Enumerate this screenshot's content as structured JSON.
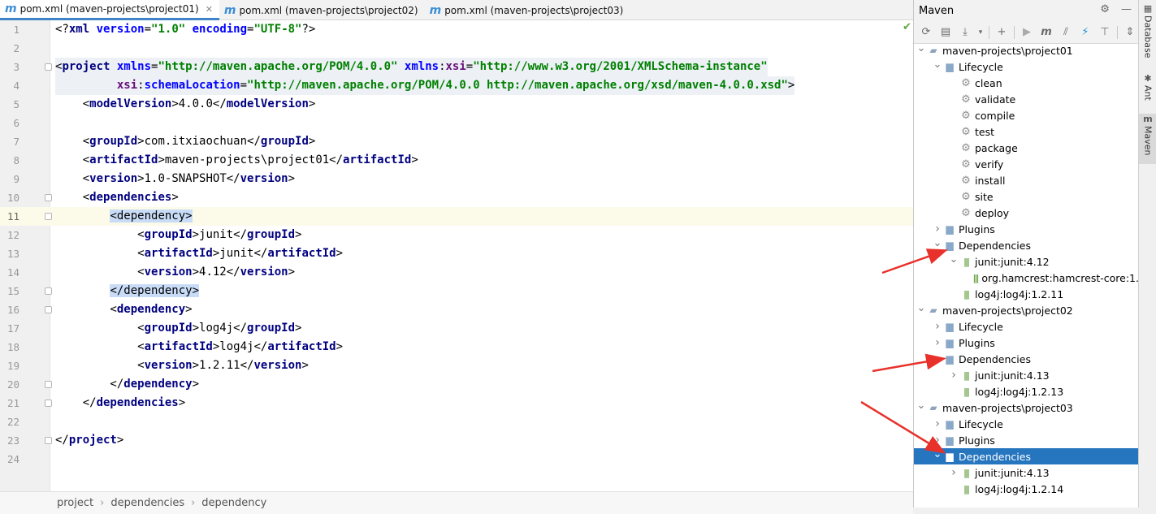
{
  "tabs": [
    {
      "label": "pom.xml (maven-projects\\project01)",
      "active": true
    },
    {
      "label": "pom.xml (maven-projects\\project02)",
      "active": false
    },
    {
      "label": "pom.xml (maven-projects\\project03)",
      "active": false
    }
  ],
  "editor": {
    "lines": [
      {
        "n": "1",
        "html": [
          [
            "pi",
            "<?"
          ],
          [
            "t",
            "xml "
          ],
          [
            "a",
            "version"
          ],
          [
            "tx",
            "="
          ],
          [
            "v",
            "\"1.0\" "
          ],
          [
            "a",
            "encoding"
          ],
          [
            "tx",
            "="
          ],
          [
            "v",
            "\"UTF-8\""
          ],
          [
            "pi",
            "?>"
          ]
        ]
      },
      {
        "n": "2",
        "html": []
      },
      {
        "n": "3",
        "fold": true,
        "hl2": true,
        "html": [
          [
            "tx",
            "<"
          ],
          [
            "t",
            "project "
          ],
          [
            "a",
            "xmlns"
          ],
          [
            "tx",
            "="
          ],
          [
            "v",
            "\"http://maven.apache.org/POM/4.0.0\" "
          ],
          [
            "a",
            "xmlns"
          ],
          [
            "tx",
            ":"
          ],
          [
            "ns",
            "xsi"
          ],
          [
            "tx",
            "="
          ],
          [
            "v",
            "\"http://www.w3.org/2001/XMLSchema-instance\""
          ]
        ]
      },
      {
        "n": "4",
        "hl2": true,
        "html": [
          [
            "tx",
            "         "
          ],
          [
            "ns",
            "xsi"
          ],
          [
            "tx",
            ":"
          ],
          [
            "a",
            "schemaLocation"
          ],
          [
            "tx",
            "="
          ],
          [
            "v",
            "\"http://maven.apache.org/POM/4.0.0 http://maven.apache.org/xsd/maven-4.0.0.xsd\""
          ],
          [
            "tx",
            ">"
          ]
        ]
      },
      {
        "n": "5",
        "html": [
          [
            "tx",
            "    <"
          ],
          [
            "t",
            "modelVersion"
          ],
          [
            "tx",
            ">4.0.0</"
          ],
          [
            "t",
            "modelVersion"
          ],
          [
            "tx",
            ">"
          ]
        ]
      },
      {
        "n": "6",
        "html": []
      },
      {
        "n": "7",
        "html": [
          [
            "tx",
            "    <"
          ],
          [
            "t",
            "groupId"
          ],
          [
            "tx",
            ">com.itxiaochuan</"
          ],
          [
            "t",
            "groupId"
          ],
          [
            "tx",
            ">"
          ]
        ]
      },
      {
        "n": "8",
        "html": [
          [
            "tx",
            "    <"
          ],
          [
            "t",
            "artifactId"
          ],
          [
            "tx",
            ">maven-projects\\project01</"
          ],
          [
            "t",
            "artifactId"
          ],
          [
            "tx",
            ">"
          ]
        ]
      },
      {
        "n": "9",
        "html": [
          [
            "tx",
            "    <"
          ],
          [
            "t",
            "version"
          ],
          [
            "tx",
            ">1.0-SNAPSHOT</"
          ],
          [
            "t",
            "version"
          ],
          [
            "tx",
            ">"
          ]
        ]
      },
      {
        "n": "10",
        "fold": true,
        "html": [
          [
            "tx",
            "    <"
          ],
          [
            "t",
            "dependencies"
          ],
          [
            "tx",
            ">"
          ]
        ]
      },
      {
        "n": "11",
        "fold": true,
        "current": true,
        "html": [
          [
            "tx",
            "        "
          ],
          [
            "hl",
            "<dependency>"
          ]
        ]
      },
      {
        "n": "12",
        "html": [
          [
            "tx",
            "            <"
          ],
          [
            "t",
            "groupId"
          ],
          [
            "tx",
            ">junit</"
          ],
          [
            "t",
            "groupId"
          ],
          [
            "tx",
            ">"
          ]
        ]
      },
      {
        "n": "13",
        "html": [
          [
            "tx",
            "            <"
          ],
          [
            "t",
            "artifactId"
          ],
          [
            "tx",
            ">junit</"
          ],
          [
            "t",
            "artifactId"
          ],
          [
            "tx",
            ">"
          ]
        ]
      },
      {
        "n": "14",
        "html": [
          [
            "tx",
            "            <"
          ],
          [
            "t",
            "version"
          ],
          [
            "tx",
            ">4.12</"
          ],
          [
            "t",
            "version"
          ],
          [
            "tx",
            ">"
          ]
        ]
      },
      {
        "n": "15",
        "fold": true,
        "html": [
          [
            "tx",
            "        "
          ],
          [
            "hl",
            "</dependency>"
          ]
        ]
      },
      {
        "n": "16",
        "fold": true,
        "html": [
          [
            "tx",
            "        <"
          ],
          [
            "t",
            "dependency"
          ],
          [
            "tx",
            ">"
          ]
        ]
      },
      {
        "n": "17",
        "html": [
          [
            "tx",
            "            <"
          ],
          [
            "t",
            "groupId"
          ],
          [
            "tx",
            ">log4j</"
          ],
          [
            "t",
            "groupId"
          ],
          [
            "tx",
            ">"
          ]
        ]
      },
      {
        "n": "18",
        "html": [
          [
            "tx",
            "            <"
          ],
          [
            "t",
            "artifactId"
          ],
          [
            "tx",
            ">log4j</"
          ],
          [
            "t",
            "artifactId"
          ],
          [
            "tx",
            ">"
          ]
        ]
      },
      {
        "n": "19",
        "html": [
          [
            "tx",
            "            <"
          ],
          [
            "t",
            "version"
          ],
          [
            "tx",
            ">1.2.11</"
          ],
          [
            "t",
            "version"
          ],
          [
            "tx",
            ">"
          ]
        ]
      },
      {
        "n": "20",
        "fold": true,
        "html": [
          [
            "tx",
            "        </"
          ],
          [
            "t",
            "dependency"
          ],
          [
            "tx",
            ">"
          ]
        ]
      },
      {
        "n": "21",
        "fold": true,
        "html": [
          [
            "tx",
            "    </"
          ],
          [
            "t",
            "dependencies"
          ],
          [
            "tx",
            ">"
          ]
        ]
      },
      {
        "n": "22",
        "html": []
      },
      {
        "n": "23",
        "fold": true,
        "html": [
          [
            "tx",
            "</"
          ],
          [
            "t",
            "project"
          ],
          [
            "tx",
            ">"
          ]
        ]
      },
      {
        "n": "24",
        "html": []
      }
    ]
  },
  "breadcrumb": [
    "project",
    "dependencies",
    "dependency"
  ],
  "maven": {
    "title": "Maven",
    "tree": [
      {
        "label": "maven-projects\\project01",
        "depth": 0,
        "arrow": "open",
        "icon": "module"
      },
      {
        "label": "Lifecycle",
        "depth": 1,
        "arrow": "open",
        "icon": "folder"
      },
      {
        "label": "clean",
        "depth": 2,
        "icon": "gear"
      },
      {
        "label": "validate",
        "depth": 2,
        "icon": "gear"
      },
      {
        "label": "compile",
        "depth": 2,
        "icon": "gear"
      },
      {
        "label": "test",
        "depth": 2,
        "icon": "gear"
      },
      {
        "label": "package",
        "depth": 2,
        "icon": "gear"
      },
      {
        "label": "verify",
        "depth": 2,
        "icon": "gear"
      },
      {
        "label": "install",
        "depth": 2,
        "icon": "gear"
      },
      {
        "label": "site",
        "depth": 2,
        "icon": "gear"
      },
      {
        "label": "deploy",
        "depth": 2,
        "icon": "gear"
      },
      {
        "label": "Plugins",
        "depth": 1,
        "arrow": "closed",
        "icon": "folder"
      },
      {
        "label": "Dependencies",
        "depth": 1,
        "arrow": "open",
        "icon": "folder"
      },
      {
        "label": "junit:junit:4.12",
        "depth": 2,
        "arrow": "open",
        "icon": "dep"
      },
      {
        "label": "org.hamcrest:hamcrest-core:1.",
        "depth": 3,
        "icon": "dep"
      },
      {
        "label": "log4j:log4j:1.2.11",
        "depth": 2,
        "icon": "dep"
      },
      {
        "label": "maven-projects\\project02",
        "depth": 0,
        "arrow": "open",
        "icon": "module"
      },
      {
        "label": "Lifecycle",
        "depth": 1,
        "arrow": "closed",
        "icon": "folder"
      },
      {
        "label": "Plugins",
        "depth": 1,
        "arrow": "closed",
        "icon": "folder"
      },
      {
        "label": "Dependencies",
        "depth": 1,
        "arrow": "open",
        "icon": "folder"
      },
      {
        "label": "junit:junit:4.13",
        "depth": 2,
        "arrow": "closed",
        "icon": "dep"
      },
      {
        "label": "log4j:log4j:1.2.13",
        "depth": 2,
        "icon": "dep"
      },
      {
        "label": "maven-projects\\project03",
        "depth": 0,
        "arrow": "open",
        "icon": "module"
      },
      {
        "label": "Lifecycle",
        "depth": 1,
        "arrow": "closed",
        "icon": "folder"
      },
      {
        "label": "Plugins",
        "depth": 1,
        "arrow": "closed",
        "icon": "folder"
      },
      {
        "label": "Dependencies",
        "depth": 1,
        "arrow": "open",
        "icon": "folder",
        "selected": true
      },
      {
        "label": "junit:junit:4.13",
        "depth": 2,
        "arrow": "closed",
        "icon": "dep"
      },
      {
        "label": "log4j:log4j:1.2.14",
        "depth": 2,
        "icon": "dep"
      }
    ]
  },
  "strip": [
    {
      "label": "Database",
      "icon": "database-icon"
    },
    {
      "label": "Ant",
      "icon": "ant-icon"
    },
    {
      "label": "Maven",
      "icon": "maven-icon",
      "active": true
    }
  ],
  "colors": {
    "arrow": "#e8312b",
    "selection": "#2675bf",
    "tag": "#000080",
    "value": "#008000"
  }
}
